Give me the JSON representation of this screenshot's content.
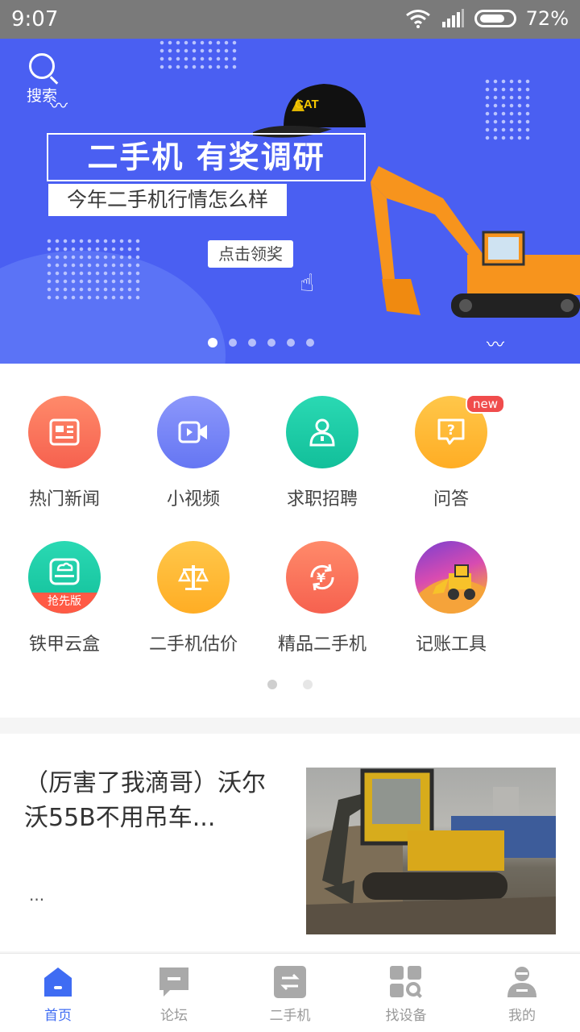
{
  "status": {
    "time": "9:07",
    "battery": "72%"
  },
  "banner": {
    "search_label": "搜索",
    "title": "二手机 有奖调研",
    "subtitle": "今年二手机行情怎么样",
    "cta": "点击领奖",
    "slide_count": 6,
    "active_slide": 0
  },
  "menu": {
    "items": [
      {
        "label": "热门新闻",
        "icon": "news-icon",
        "color": "#fb6f5c"
      },
      {
        "label": "小视频",
        "icon": "video-icon",
        "color": "#7482f7"
      },
      {
        "label": "求职招聘",
        "icon": "person-icon",
        "color": "#19c8a5"
      },
      {
        "label": "问答",
        "icon": "question-icon",
        "color": "#ffb938",
        "badge": "new"
      },
      {
        "label": "铁甲云盒",
        "icon": "cloud-box-icon",
        "color": "#19c8a5",
        "tag": "抢先版"
      },
      {
        "label": "二手机估价",
        "icon": "scale-icon",
        "color": "#ffb938"
      },
      {
        "label": "精品二手机",
        "icon": "yen-refresh-icon",
        "color": "#fb6f5c"
      },
      {
        "label": "记账工具",
        "icon": "loader-icon",
        "color": "#a24bd6"
      }
    ],
    "page_count": 2,
    "active_page": 0
  },
  "article": {
    "title": "（厉害了我滴哥）沃尔沃55B不用吊车...",
    "meta": "..."
  },
  "tabs": [
    {
      "label": "首页",
      "icon": "home-icon",
      "active": true
    },
    {
      "label": "论坛",
      "icon": "forum-icon",
      "active": false
    },
    {
      "label": "二手机",
      "icon": "swap-icon",
      "active": false
    },
    {
      "label": "找设备",
      "icon": "grid-search-icon",
      "active": false
    },
    {
      "label": "我的",
      "icon": "user-icon",
      "active": false
    }
  ],
  "colors": {
    "banner_bg": "#4a5ff2",
    "accent": "#3f6cf3"
  }
}
